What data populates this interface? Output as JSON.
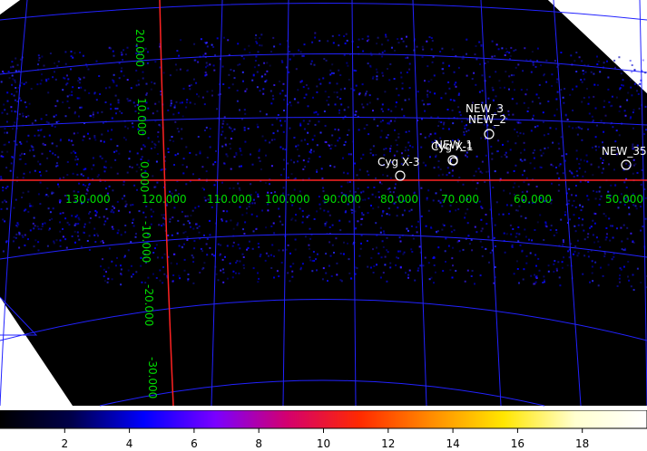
{
  "image": {
    "background_color": "#000000",
    "grid_color": "#2222ff",
    "axis_color": "#ff2222",
    "label_color": "#00dd00",
    "source_color": "#ffffff"
  },
  "longitude_labels": [
    "130.000",
    "120.000",
    "110.000",
    "100.000",
    "90.000",
    "80.000",
    "70.000",
    "60.000",
    "50.000"
  ],
  "latitude_labels": [
    "20.000",
    "10.000",
    "0.000",
    "-10.000",
    "-20.000",
    "-30.000"
  ],
  "sources": [
    {
      "name": "Cyg X-3"
    },
    {
      "name": "Cyg X-1"
    },
    {
      "name": "NEW_1"
    },
    {
      "name": "NEW_2"
    },
    {
      "name": "NEW_3"
    },
    {
      "name": "NEW_35"
    }
  ],
  "colorbar": {
    "ticks": [
      "2",
      "4",
      "6",
      "8",
      "10",
      "12",
      "14",
      "16",
      "18"
    ],
    "min": 0,
    "max": 20,
    "colormap": [
      "#000000",
      "#00004a",
      "#0000ff",
      "#7a00ff",
      "#d4006e",
      "#ff2a00",
      "#ff8c00",
      "#ffe600",
      "#ffffd0",
      "#ffffff"
    ]
  }
}
